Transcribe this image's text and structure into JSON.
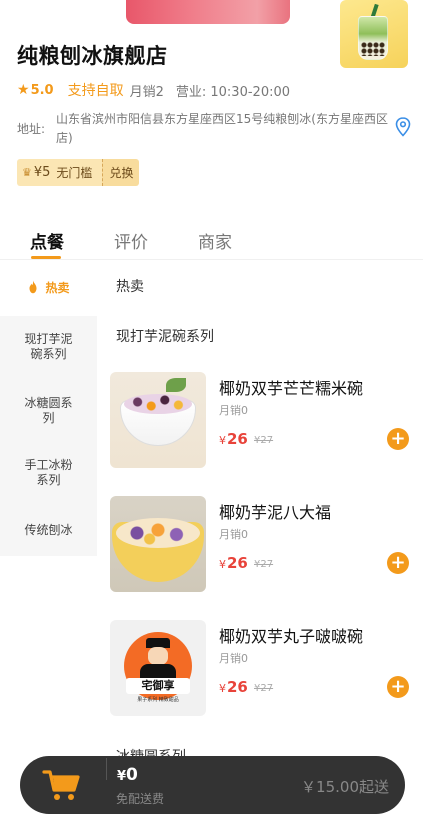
{
  "shop": {
    "name": "纯粮刨冰旗舰店",
    "rating": "5.0",
    "pickup": "支持自取",
    "monthly_sales": "月销2",
    "hours": "营业: 10:30-20:00",
    "address_label": "地址:",
    "address": "山东省滨州市阳信县东方星座西区15号纯粮刨冰(东方星座西区店)"
  },
  "coupon": {
    "amount": "¥5",
    "desc": "无门槛",
    "action": "兑换"
  },
  "tabs": [
    {
      "label": "点餐",
      "active": true
    },
    {
      "label": "评价",
      "active": false
    },
    {
      "label": "商家",
      "active": false
    }
  ],
  "sidebar": {
    "items": [
      {
        "label": "热卖",
        "active": true
      },
      {
        "label": "现打芋泥碗系列"
      },
      {
        "label": "冰糖圆系列"
      },
      {
        "label": "手工冰粉系列"
      },
      {
        "label": "传统刨冰"
      }
    ]
  },
  "sections": {
    "hot": "热卖",
    "taro": "现打芋泥碗系列",
    "next": "冰糖圆系列"
  },
  "products": [
    {
      "name": "椰奶双芋芒芒糯米碗",
      "sales": "月销0",
      "price": "26",
      "currency": "¥",
      "old_price": "¥27"
    },
    {
      "name": "椰奶芋泥八大福",
      "sales": "月销0",
      "price": "26",
      "currency": "¥",
      "old_price": "¥27"
    },
    {
      "name": "椰奶双芋丸子啵啵碗",
      "sales": "月销0",
      "price": "26",
      "currency": "¥",
      "old_price": "¥27"
    }
  ],
  "product_logo": {
    "banner": "宅御享",
    "sub": "果子系列 精致甜品"
  },
  "cart": {
    "currency": "¥",
    "total": "0",
    "delivery": "免配送费",
    "min_order": "￥15.00起送"
  },
  "colors": {
    "accent": "#f39a1b",
    "price": "#e8433a",
    "cart_bg": "#333333"
  }
}
